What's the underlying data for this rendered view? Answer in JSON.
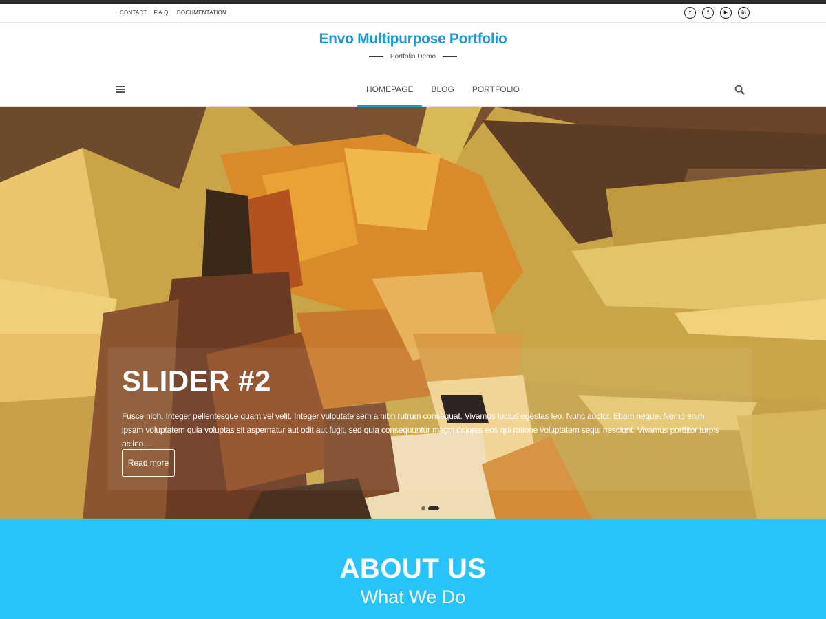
{
  "top_menu": [
    "CONTACT",
    "F.A.Q.",
    "DOCUMENTATION"
  ],
  "social_icons": [
    {
      "name": "twitter-icon",
      "glyph": "t"
    },
    {
      "name": "facebook-icon",
      "glyph": "f"
    },
    {
      "name": "youtube-icon",
      "glyph": "▶"
    },
    {
      "name": "linkedin-icon",
      "glyph": "in"
    }
  ],
  "branding": {
    "title": "Envo Multipurpose Portfolio",
    "tagline": "Portfolio Demo"
  },
  "nav": {
    "items": [
      "HOMEPAGE",
      "BLOG",
      "PORTFOLIO"
    ],
    "active": "HOMEPAGE"
  },
  "slider": {
    "title": "SLIDER #2",
    "text": "Fusce nibh. Integer pellentesque quam vel velit. Integer vulputate sem a nibh rutrum consequat. Vivamus luctus egestas leo. Nunc auctor. Etiam neque. Nemo enim ipsam voluptatem quia voluptas sit aspernatur aut odit aut fugit, sed quia consequuntur magni dolores eos qui ratione voluptatem sequi nesciunt. Vivamus porttitor turpis ac leo....",
    "button": "Read more",
    "slide_count": 2,
    "active_slide": 2
  },
  "about": {
    "title": "ABOUT US",
    "subtitle": "What We Do"
  },
  "colors": {
    "accent": "#1b9ad9",
    "about_bg": "#28c3fb",
    "top_strip": "#2b2b2b"
  }
}
